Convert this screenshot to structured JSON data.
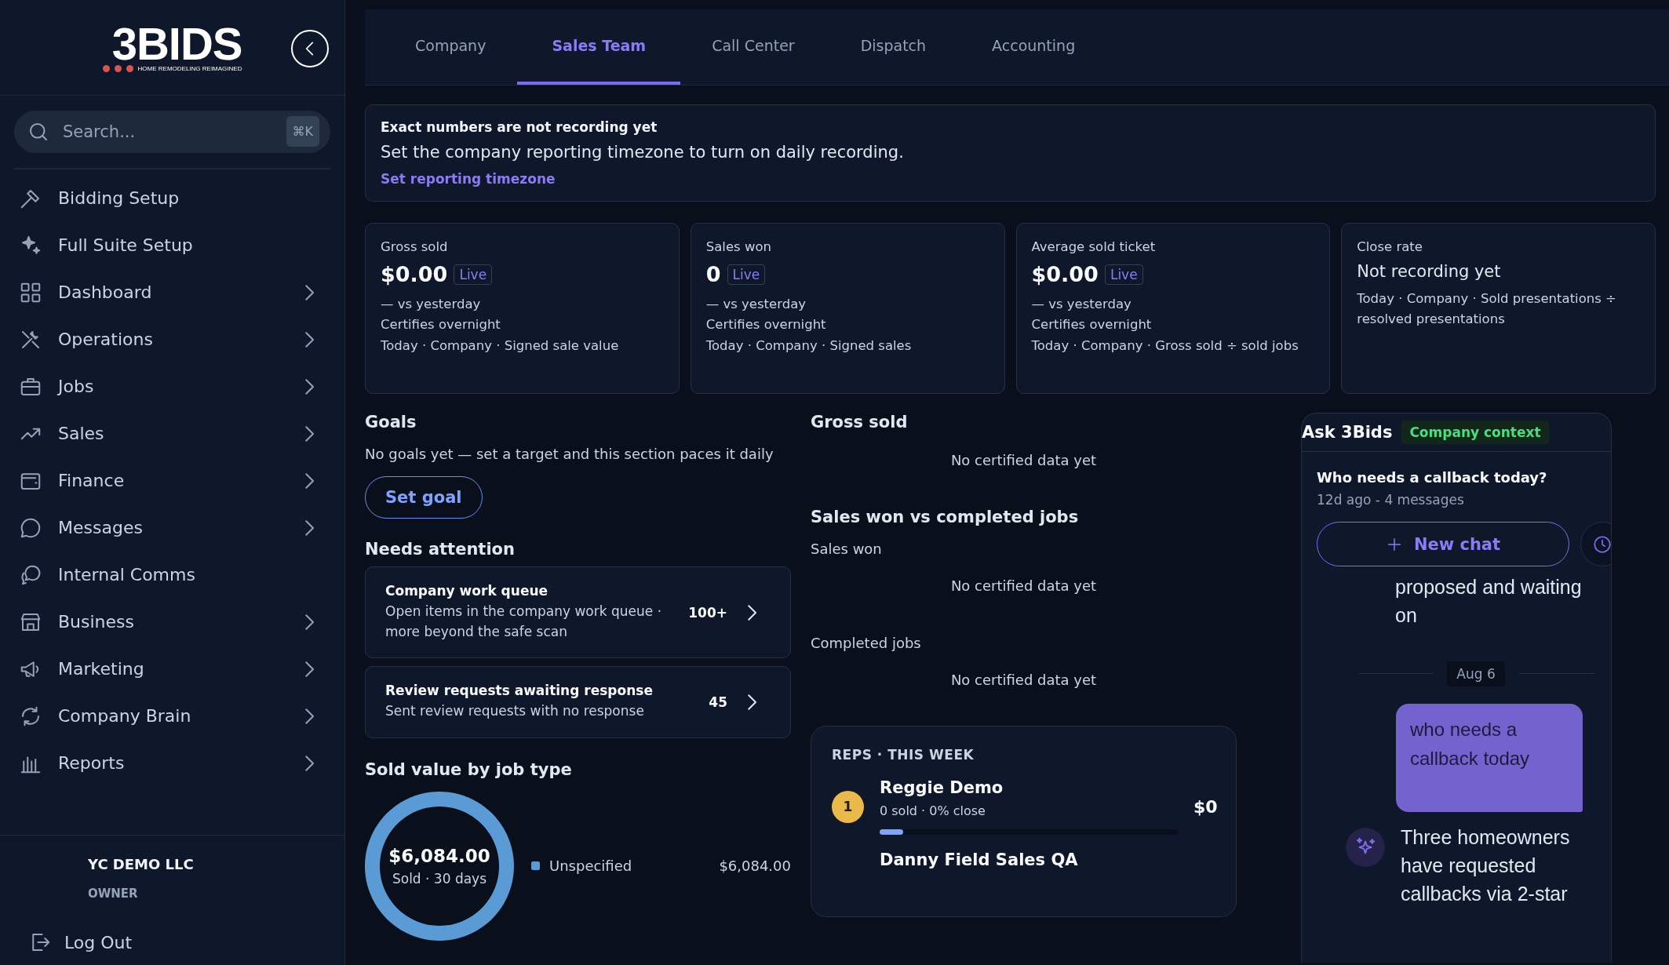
{
  "sidebar": {
    "logo": {
      "mark": "3BIDS",
      "tagline": "HOME REMODELING REIMAGINED"
    },
    "search": {
      "placeholder": "Search...",
      "shortcut": "⌘K"
    },
    "items": [
      {
        "label": "Bidding Setup",
        "expandable": false
      },
      {
        "label": "Full Suite Setup",
        "expandable": false
      },
      {
        "label": "Dashboard",
        "expandable": true
      },
      {
        "label": "Operations",
        "expandable": true
      },
      {
        "label": "Jobs",
        "expandable": true
      },
      {
        "label": "Sales",
        "expandable": true
      },
      {
        "label": "Finance",
        "expandable": true
      },
      {
        "label": "Messages",
        "expandable": true
      },
      {
        "label": "Internal Comms",
        "expandable": false
      },
      {
        "label": "Business",
        "expandable": true
      },
      {
        "label": "Marketing",
        "expandable": true
      },
      {
        "label": "Company Brain",
        "expandable": true
      },
      {
        "label": "Reports",
        "expandable": true
      }
    ],
    "account": {
      "company": "YC DEMO LLC",
      "role": "OWNER"
    },
    "logout": "Log Out"
  },
  "tabs": [
    {
      "label": "Company",
      "selected": false
    },
    {
      "label": "Sales Team",
      "selected": true
    },
    {
      "label": "Call Center",
      "selected": false
    },
    {
      "label": "Dispatch",
      "selected": false
    },
    {
      "label": "Accounting",
      "selected": false
    }
  ],
  "notice": {
    "title": "Exact numbers are not recording yet",
    "message": "Set the company reporting timezone to turn on daily recording.",
    "link": "Set reporting timezone"
  },
  "metrics": [
    {
      "kind": "live",
      "title": "Gross sold",
      "value": "$0.00",
      "badge": "Live",
      "change": "— vs yesterday",
      "note": "Certifies overnight",
      "scope": "Today · Company · Signed sale value"
    },
    {
      "kind": "live",
      "title": "Sales won",
      "value": "0",
      "badge": "Live",
      "change": "— vs yesterday",
      "note": "Certifies overnight",
      "scope": "Today · Company · Signed sales"
    },
    {
      "kind": "live",
      "title": "Average sold ticket",
      "value": "$0.00",
      "badge": "Live",
      "change": "— vs yesterday",
      "note": "Certifies overnight",
      "scope": "Today · Company · Gross sold ÷ sold jobs"
    },
    {
      "kind": "pending",
      "title": "Close rate",
      "value": "Not recording yet",
      "scope": "Today · Company · Sold presentations ÷ resolved presentations"
    }
  ],
  "goals": {
    "title": "Goals",
    "message": "No goals yet — set a target and this section paces it daily",
    "button": "Set goal"
  },
  "attention": {
    "title": "Needs attention",
    "items": [
      {
        "title": "Company work queue",
        "detail": "Open items in the company work queue · more beyond the safe scan",
        "count": "100+"
      },
      {
        "title": "Review requests awaiting response",
        "detail": "Sent review requests with no response",
        "count": "45"
      }
    ]
  },
  "sold_by_type": {
    "title": "Sold value by job type",
    "total": "$6,084.00",
    "caption": "Sold · 30 days",
    "legend": [
      {
        "label": "Unspecified",
        "value": "$6,084.00",
        "color": "#5b9bd5"
      }
    ]
  },
  "gross_sold": {
    "title": "Gross sold",
    "empty": "No certified data yet"
  },
  "won_vs_completed": {
    "title": "Sales won vs completed jobs",
    "sections": [
      {
        "label": "Sales won",
        "empty": "No certified data yet"
      },
      {
        "label": "Completed jobs",
        "empty": "No certified data yet"
      }
    ]
  },
  "reps": {
    "title": "REPS · THIS WEEK",
    "items": [
      {
        "rank": "1",
        "color": "#e9b949",
        "name": "Reggie Demo",
        "stats": "0 sold · 0% close",
        "amount": "$0",
        "level": 0.08
      },
      {
        "name": "Danny Field Sales QA"
      }
    ]
  },
  "assistant": {
    "title": "Ask 3Bids",
    "badge": "Company context",
    "conversation": {
      "title": "Who needs a callback today?",
      "meta": "12d ago - 4 messages"
    },
    "new_chat": "New chat",
    "messages": [
      {
        "kind": "continuation",
        "text": "proposed and waiting on"
      },
      {
        "kind": "date",
        "text": "Aug 6"
      },
      {
        "kind": "user",
        "text": "who needs a callback today"
      },
      {
        "kind": "assistant",
        "text": "Three homeowners have requested callbacks via 2-star"
      }
    ]
  }
}
